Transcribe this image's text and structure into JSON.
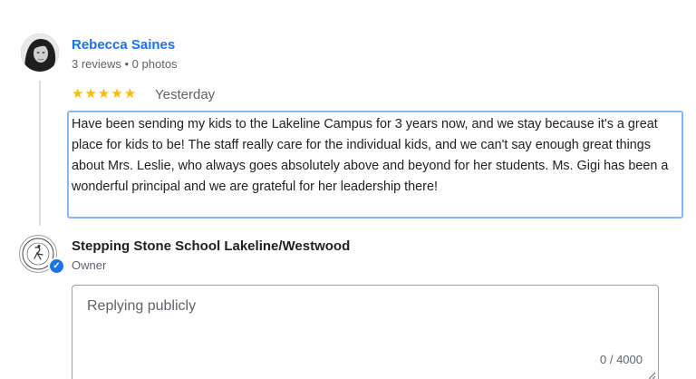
{
  "review": {
    "reviewer_name": "Rebecca Saines",
    "reviewer_meta": "3 reviews • 0 photos",
    "rating": 5,
    "stars": "★★★★★",
    "date": "Yesterday",
    "text": "Have been sending my kids to the Lakeline Campus for 3 years now, and we stay because it's a great place for kids to be! The staff really care for the individual kids, and we can't say enough great things about Mrs. Leslie, who always goes absolutely above and beyond for her students. Ms. Gigi has been a wonderful principal and we are grateful for her leadership there!"
  },
  "owner": {
    "name": "Stepping Stone School Lakeline/Westwood",
    "role": "Owner",
    "logo_text": "STEPPING STONE SCHOOL",
    "verified_icon": "verified-check-icon"
  },
  "reply": {
    "placeholder": "Replying publicly",
    "value": "",
    "char_count": "0 / 4000"
  },
  "colors": {
    "link_blue": "#1a73e8",
    "star_gold": "#fbbc04",
    "highlight_border": "#8ab4f8",
    "secondary_text": "#5f6368"
  }
}
